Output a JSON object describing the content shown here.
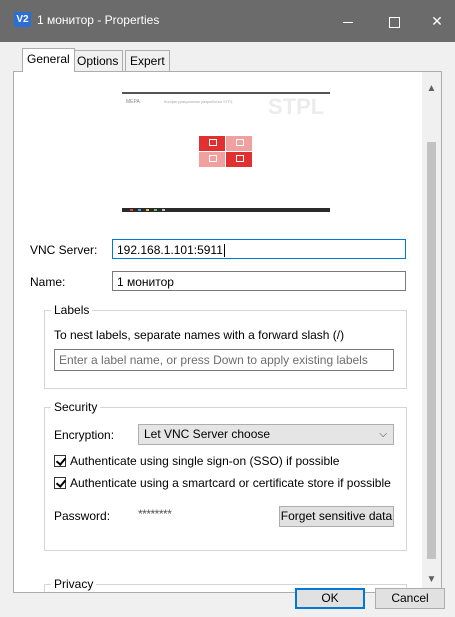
{
  "window": {
    "app_icon_text": "V2",
    "title": "1 монитор - Properties"
  },
  "tabs": [
    {
      "label": "General",
      "active": true
    },
    {
      "label": "Options",
      "active": false
    },
    {
      "label": "Expert",
      "active": false
    }
  ],
  "preview": {
    "logo_text": "MEPA",
    "subtitle": "Конфигурационная разработка STPL",
    "watermark": "STPL",
    "tile_colors": [
      "#e03030",
      "#f1a0a0",
      "#f1a0a0",
      "#e03030"
    ],
    "taskbar_color": "#2a2a2a"
  },
  "general": {
    "vnc_server_label": "VNC Server:",
    "vnc_server_value": "192.168.1.101:5911",
    "name_label": "Name:",
    "name_value": "1 монитор"
  },
  "labels_group": {
    "title": "Labels",
    "hint": "To nest labels, separate names with a forward slash (/)",
    "placeholder": "Enter a label name, or press Down to apply existing labels"
  },
  "security_group": {
    "title": "Security",
    "encryption_label": "Encryption:",
    "encryption_value": "Let VNC Server choose",
    "sso_label": "Authenticate using single sign-on (SSO) if possible",
    "sso_checked": true,
    "smartcard_label": "Authenticate using a smartcard or certificate store if possible",
    "smartcard_checked": true,
    "password_label": "Password:",
    "password_value": "********",
    "forget_button": "Forget sensitive data"
  },
  "privacy_group": {
    "title": "Privacy"
  },
  "footer": {
    "ok_label": "OK",
    "cancel_label": "Cancel"
  },
  "colors": {
    "titlebar": "#6b6b6b",
    "focus_accent": "#0078d7",
    "dialog_bg": "#f0f0f0"
  }
}
